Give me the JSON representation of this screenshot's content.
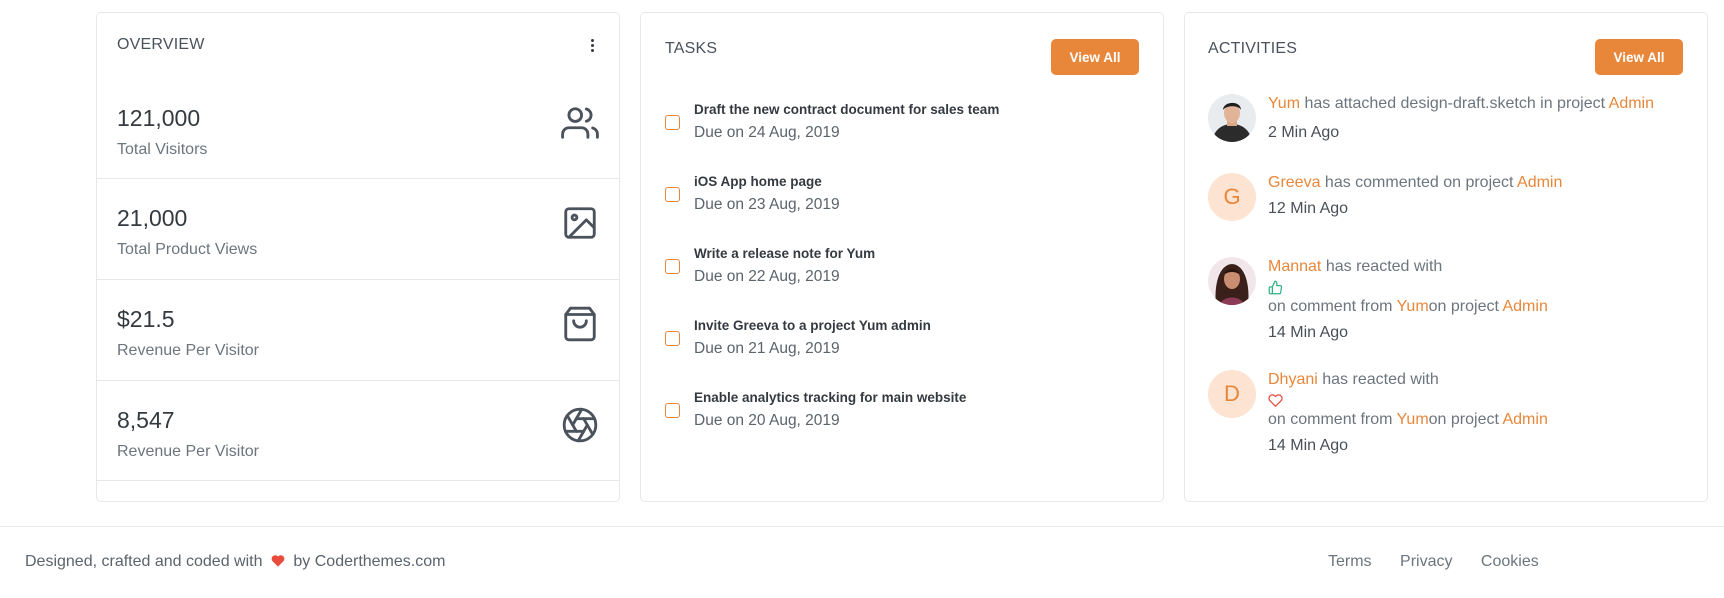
{
  "overview": {
    "title": "OVERVIEW",
    "stats": [
      {
        "value": "121,000",
        "label": "Total Visitors",
        "icon": "users-icon"
      },
      {
        "value": "21,000",
        "label": "Total Product Views",
        "icon": "image-icon"
      },
      {
        "value": "$21.5",
        "label": "Revenue Per Visitor",
        "icon": "shopping-bag-icon"
      },
      {
        "value": "8,547",
        "label": "Revenue Per Visitor",
        "icon": "aperture-icon"
      }
    ]
  },
  "tasks": {
    "title": "TASKS",
    "view_all": "View All",
    "items": [
      {
        "title": "Draft the new contract document for sales team",
        "due": "Due on 24 Aug, 2019"
      },
      {
        "title": "iOS App home page",
        "due": "Due on 23 Aug, 2019"
      },
      {
        "title": "Write a release note for Yum",
        "due": "Due on 22 Aug, 2019"
      },
      {
        "title": "Invite Greeva to a project Yum admin",
        "due": "Due on 21 Aug, 2019"
      },
      {
        "title": "Enable analytics tracking for main website",
        "due": "Due on 20 Aug, 2019"
      }
    ]
  },
  "activities": {
    "title": "ACTIVITIES",
    "view_all": "View All",
    "items": [
      {
        "user": "Yum",
        "text": " has attached design-draft.sketch in project ",
        "project": "Admin",
        "time": "2 Min Ago"
      },
      {
        "user": "Greeva",
        "avatar_letter": "G",
        "text": " has commented on project ",
        "project": "Admin",
        "time": "12 Min Ago"
      },
      {
        "user": "Mannat",
        "text": " has reacted with",
        "reaction": "thumbs-up-icon",
        "line2_a": "on comment from ",
        "target": "Yum",
        "line2_b": "on project ",
        "project": "Admin",
        "time": "14 Min Ago"
      },
      {
        "user": "Dhyani",
        "avatar_letter": "D",
        "text": " has reacted with",
        "reaction": "heart-icon",
        "line2_a": "on comment from ",
        "target": "Yum",
        "line2_b": "on project ",
        "project": "Admin",
        "time": "14 Min Ago"
      }
    ]
  },
  "footer": {
    "credit_prefix": "Designed, crafted and coded with",
    "credit_suffix": "by Coderthemes.com",
    "links": [
      "Terms",
      "Privacy",
      "Cookies"
    ]
  },
  "colors": {
    "accent": "#e8873a",
    "border": "#e6e8eb",
    "heart": "#e74c3c",
    "success": "#2fb380"
  }
}
